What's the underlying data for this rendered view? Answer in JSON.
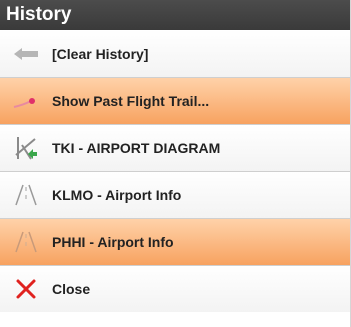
{
  "header": {
    "title": "History"
  },
  "colors": {
    "header_bg": "#404040",
    "highlight": "#f7a260",
    "close_red": "#e0221f",
    "diagram_green": "#3aa64a"
  },
  "items": [
    {
      "label": "[Clear History]",
      "icon": "back-arrow-icon",
      "highlighted": false
    },
    {
      "label": "Show Past Flight Trail...",
      "icon": "flight-trail-icon",
      "highlighted": true
    },
    {
      "label": "TKI - AIRPORT DIAGRAM",
      "icon": "airport-diagram-icon",
      "highlighted": false
    },
    {
      "label": "KLMO - Airport Info",
      "icon": "runway-icon",
      "highlighted": false
    },
    {
      "label": "PHHI - Airport Info",
      "icon": "runway-icon",
      "highlighted": true
    },
    {
      "label": "Close",
      "icon": "close-icon",
      "highlighted": false
    }
  ]
}
